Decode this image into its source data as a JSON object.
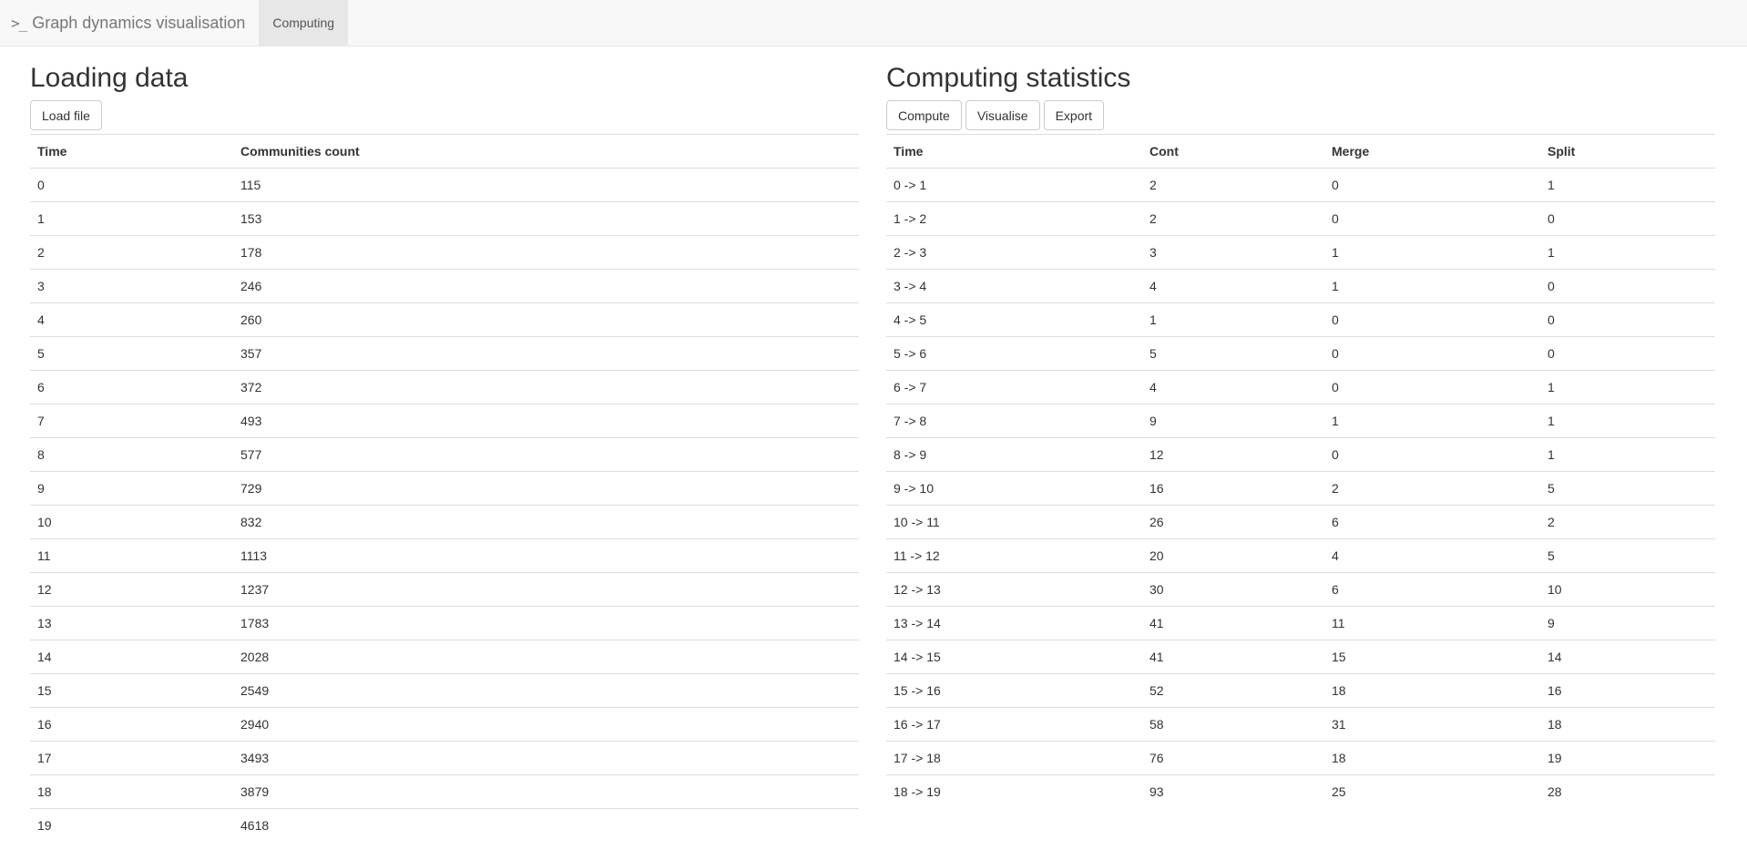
{
  "navbar": {
    "brand_icon": ">_",
    "brand_label": "Graph dynamics visualisation",
    "tab_label": "Computing"
  },
  "loading": {
    "title": "Loading data",
    "load_button": "Load file",
    "columns": [
      "Time",
      "Communities count"
    ],
    "rows": [
      [
        "0",
        "115"
      ],
      [
        "1",
        "153"
      ],
      [
        "2",
        "178"
      ],
      [
        "3",
        "246"
      ],
      [
        "4",
        "260"
      ],
      [
        "5",
        "357"
      ],
      [
        "6",
        "372"
      ],
      [
        "7",
        "493"
      ],
      [
        "8",
        "577"
      ],
      [
        "9",
        "729"
      ],
      [
        "10",
        "832"
      ],
      [
        "11",
        "1113"
      ],
      [
        "12",
        "1237"
      ],
      [
        "13",
        "1783"
      ],
      [
        "14",
        "2028"
      ],
      [
        "15",
        "2549"
      ],
      [
        "16",
        "2940"
      ],
      [
        "17",
        "3493"
      ],
      [
        "18",
        "3879"
      ],
      [
        "19",
        "4618"
      ]
    ]
  },
  "stats": {
    "title": "Computing statistics",
    "compute_button": "Compute",
    "visualise_button": "Visualise",
    "export_button": "Export",
    "columns": [
      "Time",
      "Cont",
      "Merge",
      "Split"
    ],
    "rows": [
      [
        "0 -> 1",
        "2",
        "0",
        "1"
      ],
      [
        "1 -> 2",
        "2",
        "0",
        "0"
      ],
      [
        "2 -> 3",
        "3",
        "1",
        "1"
      ],
      [
        "3 -> 4",
        "4",
        "1",
        "0"
      ],
      [
        "4 -> 5",
        "1",
        "0",
        "0"
      ],
      [
        "5 -> 6",
        "5",
        "0",
        "0"
      ],
      [
        "6 -> 7",
        "4",
        "0",
        "1"
      ],
      [
        "7 -> 8",
        "9",
        "1",
        "1"
      ],
      [
        "8 -> 9",
        "12",
        "0",
        "1"
      ],
      [
        "9 -> 10",
        "16",
        "2",
        "5"
      ],
      [
        "10 -> 11",
        "26",
        "6",
        "2"
      ],
      [
        "11 -> 12",
        "20",
        "4",
        "5"
      ],
      [
        "12 -> 13",
        "30",
        "6",
        "10"
      ],
      [
        "13 -> 14",
        "41",
        "11",
        "9"
      ],
      [
        "14 -> 15",
        "41",
        "15",
        "14"
      ],
      [
        "15 -> 16",
        "52",
        "18",
        "16"
      ],
      [
        "16 -> 17",
        "58",
        "31",
        "18"
      ],
      [
        "17 -> 18",
        "76",
        "18",
        "19"
      ],
      [
        "18 -> 19",
        "93",
        "25",
        "28"
      ]
    ]
  }
}
